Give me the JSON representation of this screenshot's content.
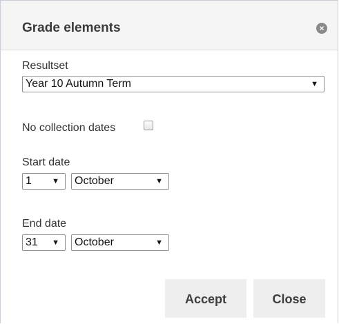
{
  "dialog": {
    "title": "Grade elements",
    "close_glyph": "×"
  },
  "resultset": {
    "label": "Resultset",
    "selected": "Year 10 Autumn Term"
  },
  "collection": {
    "label": "No collection dates",
    "checked": false
  },
  "start_date": {
    "label": "Start date",
    "day": "1",
    "month": "October"
  },
  "end_date": {
    "label": "End date",
    "day": "31",
    "month": "October"
  },
  "buttons": {
    "accept_label": "Accept",
    "close_label": "Close"
  },
  "icons": {
    "dropdown_arrow": "▼",
    "close": "close-circle-icon"
  }
}
